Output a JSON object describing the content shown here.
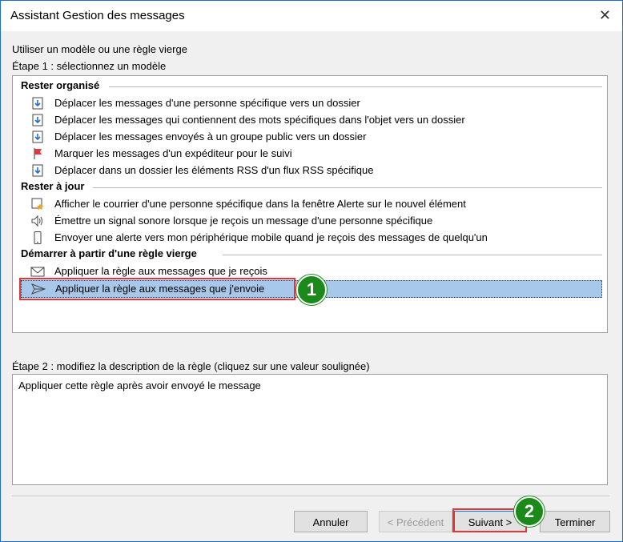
{
  "window": {
    "title": "Assistant Gestion des messages"
  },
  "intro": {
    "line1": "Utiliser un modèle ou une règle vierge",
    "step1": "Étape 1 : sélectionnez un modèle"
  },
  "sections": {
    "organise": {
      "title": "Rester organisé"
    },
    "ajour": {
      "title": "Rester à jour"
    },
    "vierge": {
      "title": "Démarrer à partir d'une règle vierge"
    }
  },
  "items": [
    {
      "label": "Déplacer les messages d'une personne spécifique vers un dossier",
      "icon": "move-to-folder-icon"
    },
    {
      "label": "Déplacer les messages qui contiennent des mots spécifiques dans l'objet vers un dossier",
      "icon": "move-to-folder-icon"
    },
    {
      "label": "Déplacer les messages envoyés à un groupe public vers un dossier",
      "icon": "move-to-folder-icon"
    },
    {
      "label": "Marquer les messages d'un expéditeur pour le suivi",
      "icon": "red-flag-icon"
    },
    {
      "label": "Déplacer dans un dossier les éléments RSS d'un flux RSS spécifique",
      "icon": "move-to-folder-icon"
    },
    {
      "label": "Afficher le courrier d'une personne spécifique dans la fenêtre Alerte sur le nouvel élément",
      "icon": "alert-window-icon"
    },
    {
      "label": "Émettre un signal sonore lorsque je reçois un message d'une personne spécifique",
      "icon": "speaker-icon"
    },
    {
      "label": "Envoyer une alerte vers mon périphérique mobile quand je reçois des messages de quelqu'un",
      "icon": "mobile-phone-icon"
    },
    {
      "label": "Appliquer la règle aux messages que je reçois",
      "icon": "envelope-icon"
    },
    {
      "label": "Appliquer la règle aux messages que j'envoie",
      "icon": "send-icon",
      "selected": true
    }
  ],
  "badges": {
    "one": "1",
    "two": "2"
  },
  "step2": {
    "label": "Étape 2 : modifiez la description de la règle (cliquez sur une valeur soulignée)",
    "description": "Appliquer cette règle après avoir envoyé le message"
  },
  "buttons": {
    "cancel": "Annuler",
    "previous": "< Précédent",
    "next": "Suivant >",
    "finish": "Terminer"
  },
  "colors": {
    "selection": "#a7c8ea",
    "highlight_box": "#e4353a",
    "badge": "#1b8a1b"
  }
}
